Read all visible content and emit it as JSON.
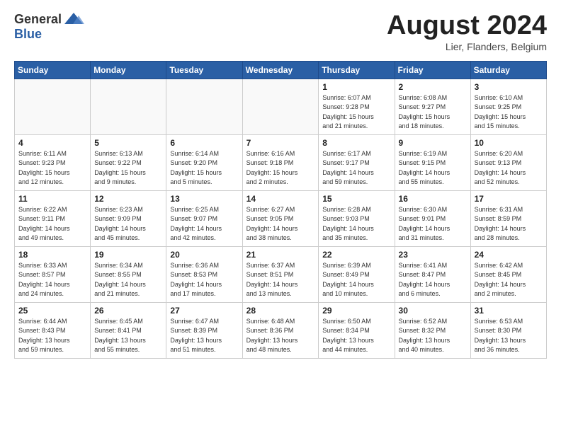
{
  "header": {
    "logo_general": "General",
    "logo_blue": "Blue",
    "month_title": "August 2024",
    "location": "Lier, Flanders, Belgium"
  },
  "weekdays": [
    "Sunday",
    "Monday",
    "Tuesday",
    "Wednesday",
    "Thursday",
    "Friday",
    "Saturday"
  ],
  "weeks": [
    [
      {
        "day": "",
        "info": ""
      },
      {
        "day": "",
        "info": ""
      },
      {
        "day": "",
        "info": ""
      },
      {
        "day": "",
        "info": ""
      },
      {
        "day": "1",
        "info": "Sunrise: 6:07 AM\nSunset: 9:28 PM\nDaylight: 15 hours\nand 21 minutes."
      },
      {
        "day": "2",
        "info": "Sunrise: 6:08 AM\nSunset: 9:27 PM\nDaylight: 15 hours\nand 18 minutes."
      },
      {
        "day": "3",
        "info": "Sunrise: 6:10 AM\nSunset: 9:25 PM\nDaylight: 15 hours\nand 15 minutes."
      }
    ],
    [
      {
        "day": "4",
        "info": "Sunrise: 6:11 AM\nSunset: 9:23 PM\nDaylight: 15 hours\nand 12 minutes."
      },
      {
        "day": "5",
        "info": "Sunrise: 6:13 AM\nSunset: 9:22 PM\nDaylight: 15 hours\nand 9 minutes."
      },
      {
        "day": "6",
        "info": "Sunrise: 6:14 AM\nSunset: 9:20 PM\nDaylight: 15 hours\nand 5 minutes."
      },
      {
        "day": "7",
        "info": "Sunrise: 6:16 AM\nSunset: 9:18 PM\nDaylight: 15 hours\nand 2 minutes."
      },
      {
        "day": "8",
        "info": "Sunrise: 6:17 AM\nSunset: 9:17 PM\nDaylight: 14 hours\nand 59 minutes."
      },
      {
        "day": "9",
        "info": "Sunrise: 6:19 AM\nSunset: 9:15 PM\nDaylight: 14 hours\nand 55 minutes."
      },
      {
        "day": "10",
        "info": "Sunrise: 6:20 AM\nSunset: 9:13 PM\nDaylight: 14 hours\nand 52 minutes."
      }
    ],
    [
      {
        "day": "11",
        "info": "Sunrise: 6:22 AM\nSunset: 9:11 PM\nDaylight: 14 hours\nand 49 minutes."
      },
      {
        "day": "12",
        "info": "Sunrise: 6:23 AM\nSunset: 9:09 PM\nDaylight: 14 hours\nand 45 minutes."
      },
      {
        "day": "13",
        "info": "Sunrise: 6:25 AM\nSunset: 9:07 PM\nDaylight: 14 hours\nand 42 minutes."
      },
      {
        "day": "14",
        "info": "Sunrise: 6:27 AM\nSunset: 9:05 PM\nDaylight: 14 hours\nand 38 minutes."
      },
      {
        "day": "15",
        "info": "Sunrise: 6:28 AM\nSunset: 9:03 PM\nDaylight: 14 hours\nand 35 minutes."
      },
      {
        "day": "16",
        "info": "Sunrise: 6:30 AM\nSunset: 9:01 PM\nDaylight: 14 hours\nand 31 minutes."
      },
      {
        "day": "17",
        "info": "Sunrise: 6:31 AM\nSunset: 8:59 PM\nDaylight: 14 hours\nand 28 minutes."
      }
    ],
    [
      {
        "day": "18",
        "info": "Sunrise: 6:33 AM\nSunset: 8:57 PM\nDaylight: 14 hours\nand 24 minutes."
      },
      {
        "day": "19",
        "info": "Sunrise: 6:34 AM\nSunset: 8:55 PM\nDaylight: 14 hours\nand 21 minutes."
      },
      {
        "day": "20",
        "info": "Sunrise: 6:36 AM\nSunset: 8:53 PM\nDaylight: 14 hours\nand 17 minutes."
      },
      {
        "day": "21",
        "info": "Sunrise: 6:37 AM\nSunset: 8:51 PM\nDaylight: 14 hours\nand 13 minutes."
      },
      {
        "day": "22",
        "info": "Sunrise: 6:39 AM\nSunset: 8:49 PM\nDaylight: 14 hours\nand 10 minutes."
      },
      {
        "day": "23",
        "info": "Sunrise: 6:41 AM\nSunset: 8:47 PM\nDaylight: 14 hours\nand 6 minutes."
      },
      {
        "day": "24",
        "info": "Sunrise: 6:42 AM\nSunset: 8:45 PM\nDaylight: 14 hours\nand 2 minutes."
      }
    ],
    [
      {
        "day": "25",
        "info": "Sunrise: 6:44 AM\nSunset: 8:43 PM\nDaylight: 13 hours\nand 59 minutes."
      },
      {
        "day": "26",
        "info": "Sunrise: 6:45 AM\nSunset: 8:41 PM\nDaylight: 13 hours\nand 55 minutes."
      },
      {
        "day": "27",
        "info": "Sunrise: 6:47 AM\nSunset: 8:39 PM\nDaylight: 13 hours\nand 51 minutes."
      },
      {
        "day": "28",
        "info": "Sunrise: 6:48 AM\nSunset: 8:36 PM\nDaylight: 13 hours\nand 48 minutes."
      },
      {
        "day": "29",
        "info": "Sunrise: 6:50 AM\nSunset: 8:34 PM\nDaylight: 13 hours\nand 44 minutes."
      },
      {
        "day": "30",
        "info": "Sunrise: 6:52 AM\nSunset: 8:32 PM\nDaylight: 13 hours\nand 40 minutes."
      },
      {
        "day": "31",
        "info": "Sunrise: 6:53 AM\nSunset: 8:30 PM\nDaylight: 13 hours\nand 36 minutes."
      }
    ]
  ]
}
